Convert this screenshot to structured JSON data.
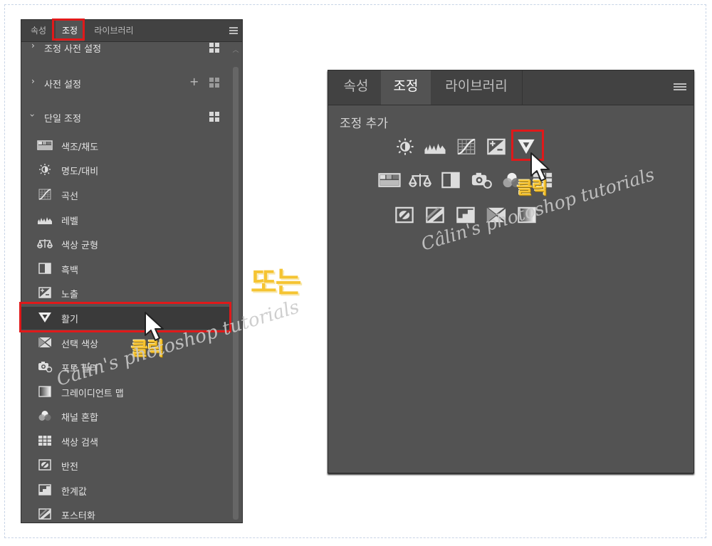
{
  "left_panel": {
    "tabs": [
      "속성",
      "조정",
      "라이브러리"
    ],
    "active_tab": "조정",
    "groups": [
      {
        "label": "조정 사전 설정",
        "icon": "grid-icon"
      },
      {
        "label": "사전 설정",
        "icon": "grid-icon"
      },
      {
        "label": "단일 조정",
        "icon": "grid-icon"
      }
    ],
    "items": [
      {
        "label": "색조/채도",
        "icon": "hue-saturation-icon"
      },
      {
        "label": "명도/대비",
        "icon": "brightness-contrast-icon"
      },
      {
        "label": "곡선",
        "icon": "curves-icon"
      },
      {
        "label": "레벨",
        "icon": "levels-icon"
      },
      {
        "label": "색상 균형",
        "icon": "color-balance-icon"
      },
      {
        "label": "흑백",
        "icon": "black-white-icon"
      },
      {
        "label": "노출",
        "icon": "exposure-icon"
      },
      {
        "label": "활기",
        "icon": "vibrance-icon"
      },
      {
        "label": "선택 색상",
        "icon": "selective-color-icon"
      },
      {
        "label": "포토 필터",
        "icon": "photo-filter-icon"
      },
      {
        "label": "그레이디언트 맵",
        "icon": "gradient-map-icon"
      },
      {
        "label": "채널 혼합",
        "icon": "channel-mixer-icon"
      },
      {
        "label": "색상 검색",
        "icon": "color-lookup-icon"
      },
      {
        "label": "반전",
        "icon": "invert-icon"
      },
      {
        "label": "한계값",
        "icon": "threshold-icon"
      },
      {
        "label": "포스터화",
        "icon": "posterize-icon"
      }
    ],
    "selected_item": "활기"
  },
  "right_panel": {
    "tabs": [
      "속성",
      "조정",
      "라이브러리"
    ],
    "active_tab": "조정",
    "subtitle": "조정 추가"
  },
  "overlay": {
    "or_text": "또는",
    "click_text": "클릭",
    "watermark": "Câlin's photoshop tutorials"
  },
  "colors": {
    "panel_bg": "#535353",
    "tab_bg": "#424242",
    "highlight": "#e0191a",
    "accent_yellow": "#f5c432"
  }
}
